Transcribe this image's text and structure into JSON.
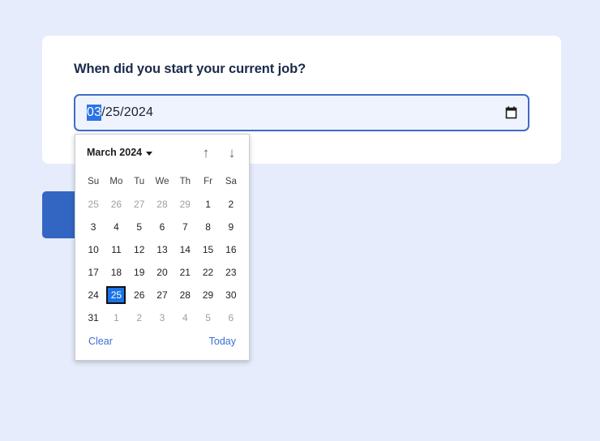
{
  "page": {
    "background_color": "#e6ecfc"
  },
  "form": {
    "title": "When did you start your current job?",
    "date_input": {
      "month_segment": "03",
      "separator1": "/",
      "day_segment": "25",
      "separator2": "/",
      "year_segment": "2024",
      "full_value": "03/25/2024",
      "selected_segment": "month",
      "icon": "calendar-icon",
      "border_color": "#3f6bc4",
      "fill_color": "#eef3fe",
      "selection_color": "#2a72e5"
    },
    "submit_button": {
      "label": "",
      "color": "#3366c2"
    }
  },
  "datepicker": {
    "header": {
      "month_year": "March 2024",
      "dropdown_icon": "chevron-down-icon",
      "prev_icon": "↑",
      "next_icon": "↓"
    },
    "weekdays": [
      "Su",
      "Mo",
      "Tu",
      "We",
      "Th",
      "Fr",
      "Sa"
    ],
    "weeks": [
      [
        {
          "day": "25",
          "muted": true,
          "selected": false
        },
        {
          "day": "26",
          "muted": true,
          "selected": false
        },
        {
          "day": "27",
          "muted": true,
          "selected": false
        },
        {
          "day": "28",
          "muted": true,
          "selected": false
        },
        {
          "day": "29",
          "muted": true,
          "selected": false
        },
        {
          "day": "1",
          "muted": false,
          "selected": false
        },
        {
          "day": "2",
          "muted": false,
          "selected": false
        }
      ],
      [
        {
          "day": "3",
          "muted": false,
          "selected": false
        },
        {
          "day": "4",
          "muted": false,
          "selected": false
        },
        {
          "day": "5",
          "muted": false,
          "selected": false
        },
        {
          "day": "6",
          "muted": false,
          "selected": false
        },
        {
          "day": "7",
          "muted": false,
          "selected": false
        },
        {
          "day": "8",
          "muted": false,
          "selected": false
        },
        {
          "day": "9",
          "muted": false,
          "selected": false
        }
      ],
      [
        {
          "day": "10",
          "muted": false,
          "selected": false
        },
        {
          "day": "11",
          "muted": false,
          "selected": false
        },
        {
          "day": "12",
          "muted": false,
          "selected": false
        },
        {
          "day": "13",
          "muted": false,
          "selected": false
        },
        {
          "day": "14",
          "muted": false,
          "selected": false
        },
        {
          "day": "15",
          "muted": false,
          "selected": false
        },
        {
          "day": "16",
          "muted": false,
          "selected": false
        }
      ],
      [
        {
          "day": "17",
          "muted": false,
          "selected": false
        },
        {
          "day": "18",
          "muted": false,
          "selected": false
        },
        {
          "day": "19",
          "muted": false,
          "selected": false
        },
        {
          "day": "20",
          "muted": false,
          "selected": false
        },
        {
          "day": "21",
          "muted": false,
          "selected": false
        },
        {
          "day": "22",
          "muted": false,
          "selected": false
        },
        {
          "day": "23",
          "muted": false,
          "selected": false
        }
      ],
      [
        {
          "day": "24",
          "muted": false,
          "selected": false
        },
        {
          "day": "25",
          "muted": false,
          "selected": true
        },
        {
          "day": "26",
          "muted": false,
          "selected": false
        },
        {
          "day": "27",
          "muted": false,
          "selected": false
        },
        {
          "day": "28",
          "muted": false,
          "selected": false
        },
        {
          "day": "29",
          "muted": false,
          "selected": false
        },
        {
          "day": "30",
          "muted": false,
          "selected": false
        }
      ],
      [
        {
          "day": "31",
          "muted": false,
          "selected": false
        },
        {
          "day": "1",
          "muted": true,
          "selected": false
        },
        {
          "day": "2",
          "muted": true,
          "selected": false
        },
        {
          "day": "3",
          "muted": true,
          "selected": false
        },
        {
          "day": "4",
          "muted": true,
          "selected": false
        },
        {
          "day": "5",
          "muted": true,
          "selected": false
        },
        {
          "day": "6",
          "muted": true,
          "selected": false
        }
      ]
    ],
    "footer": {
      "clear_label": "Clear",
      "today_label": "Today"
    },
    "selected_color": "#1a73e8",
    "link_color": "#3b6fd4"
  }
}
